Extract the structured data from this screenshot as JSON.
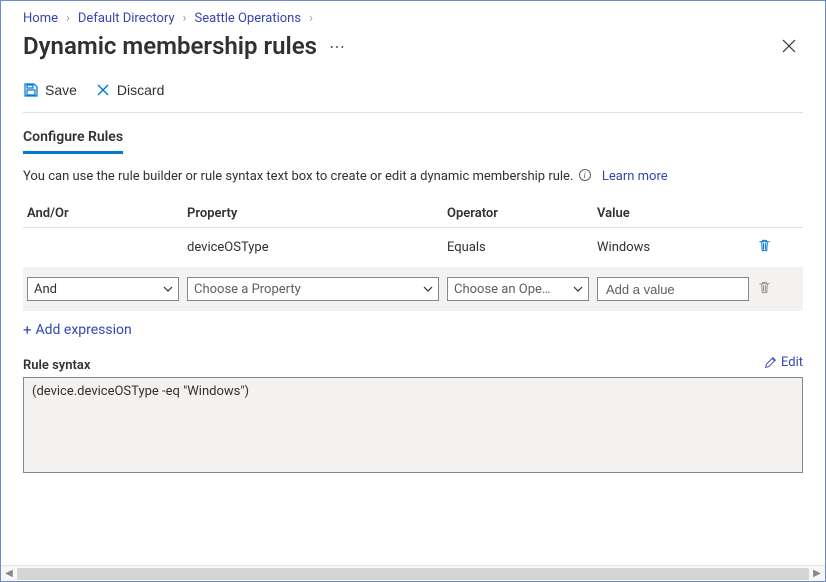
{
  "breadcrumb": {
    "items": [
      {
        "label": "Home"
      },
      {
        "label": "Default Directory"
      },
      {
        "label": "Seattle Operations"
      }
    ]
  },
  "title": "Dynamic membership rules",
  "toolbar": {
    "save_label": "Save",
    "discard_label": "Discard"
  },
  "tabs": {
    "configure_label": "Configure Rules"
  },
  "help": {
    "text": "You can use the rule builder or rule syntax text box to create or edit a dynamic membership rule.",
    "learn_more_label": "Learn more"
  },
  "table": {
    "headers": {
      "andor": "And/Or",
      "property": "Property",
      "operator": "Operator",
      "value": "Value"
    },
    "rows": [
      {
        "andor": "",
        "property": "deviceOSType",
        "operator": "Equals",
        "value": "Windows"
      }
    ],
    "edit_row": {
      "andor_selected": "And",
      "property_placeholder": "Choose a Property",
      "operator_placeholder": "Choose an Ope…",
      "value_placeholder": "Add a value"
    }
  },
  "add_expression_label": "Add expression",
  "syntax": {
    "label": "Rule syntax",
    "edit_label": "Edit",
    "text": "(device.deviceOSType -eq \"Windows\")"
  }
}
